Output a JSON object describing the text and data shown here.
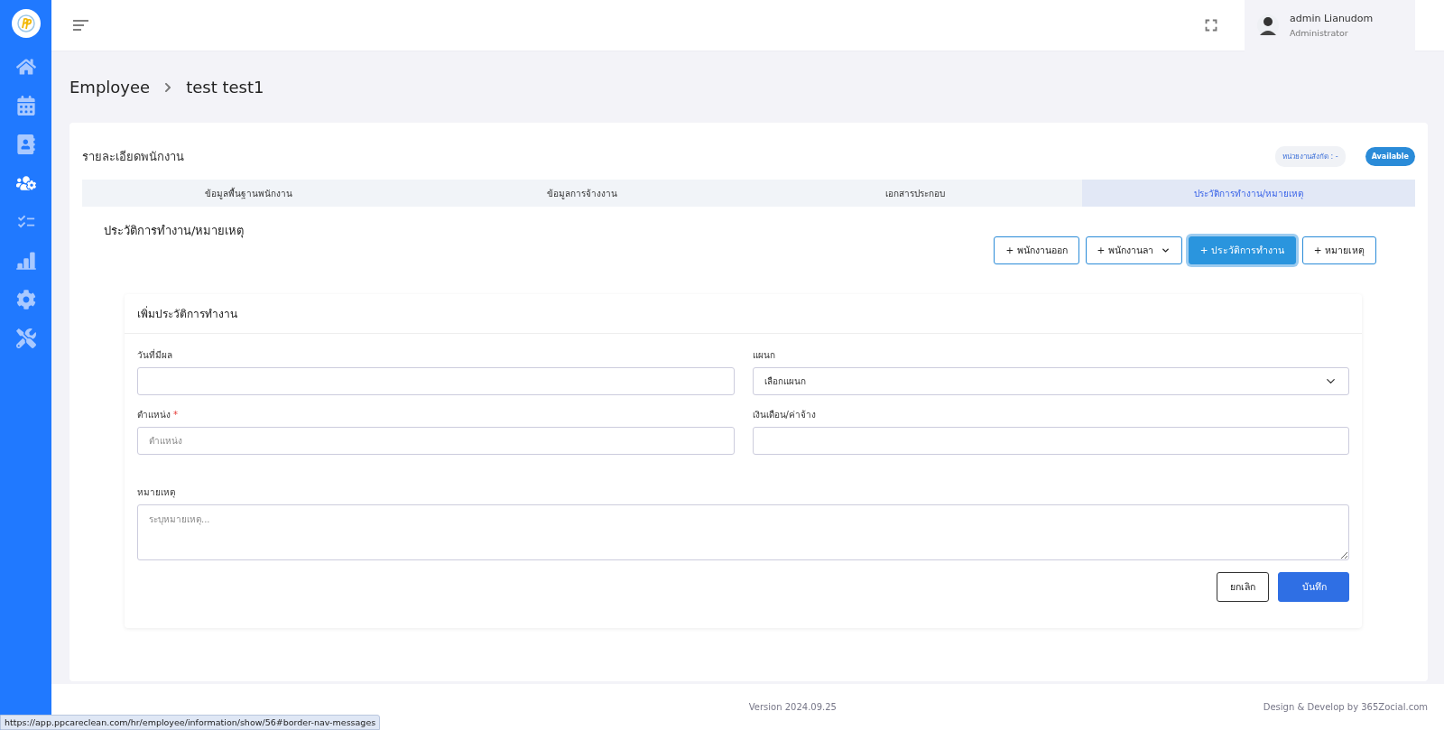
{
  "sidebar": {
    "items": [
      {
        "selected": false
      },
      {
        "selected": false
      },
      {
        "selected": false
      },
      {
        "selected": true
      },
      {
        "selected": false
      },
      {
        "selected": false
      },
      {
        "selected": false
      },
      {
        "selected": false
      }
    ]
  },
  "header": {
    "user": {
      "name": "admin Lianudom",
      "role": "Administrator"
    }
  },
  "breadcrumb": [
    "Employee",
    "test test1"
  ],
  "card": {
    "title": "รายละเอียดพนักงาน",
    "unit_badge": "หน่วยงานสังกัด : -",
    "status_badge": "Available",
    "tabs": [
      {
        "label": "ข้อมูลพื้นฐานพนักงาน",
        "selected": false
      },
      {
        "label": "ข้อมูลการจ้างงาน",
        "selected": false
      },
      {
        "label": "เอกสารประกอบ",
        "selected": false
      },
      {
        "label": "ประวัติการทำงาน/หมายเหตุ",
        "selected": true
      }
    ],
    "section_title": "ประวัติการทำงาน/หมายเหตุ",
    "actions": [
      {
        "label": "+ พนักงานออก",
        "kind": "outline",
        "selected": false
      },
      {
        "label": "+  พนักงานลา",
        "kind": "dropdown",
        "selected": false
      },
      {
        "label": "+ ประวัติการทำงาน",
        "kind": "outline",
        "selected": true
      },
      {
        "label": "+ หมายเหตุ",
        "kind": "outline",
        "selected": false
      }
    ],
    "form": {
      "title": "เพิ่มประวัติการทำงาน",
      "fields": [
        {
          "label": "วันที่มีผล",
          "kind": "input"
        },
        {
          "label": "แผนก",
          "kind": "select",
          "value": "เลือกแผนก"
        },
        {
          "label": "ตำแหน่ง",
          "kind": "input",
          "placeholder": "ตำแหน่ง",
          "required_mark": "*"
        },
        {
          "label": "เงินเดือน/ค่าจ้าง",
          "kind": "input"
        },
        {
          "label": "หมายเหตุ",
          "kind": "textarea",
          "placeholder": "ระบุหมายเหตุ..."
        }
      ],
      "buttons": [
        {
          "label": "ยกเลิก",
          "kind": "secondary"
        },
        {
          "label": "บันทึก",
          "kind": "primary"
        }
      ]
    }
  },
  "footer": {
    "version": "Version 2024.09.25",
    "credit": "Design & Develop by 365Zocial.com"
  },
  "status_url": "https://app.ppcareclean.com/hr/employee/information/show/56#border-nav-messages"
}
